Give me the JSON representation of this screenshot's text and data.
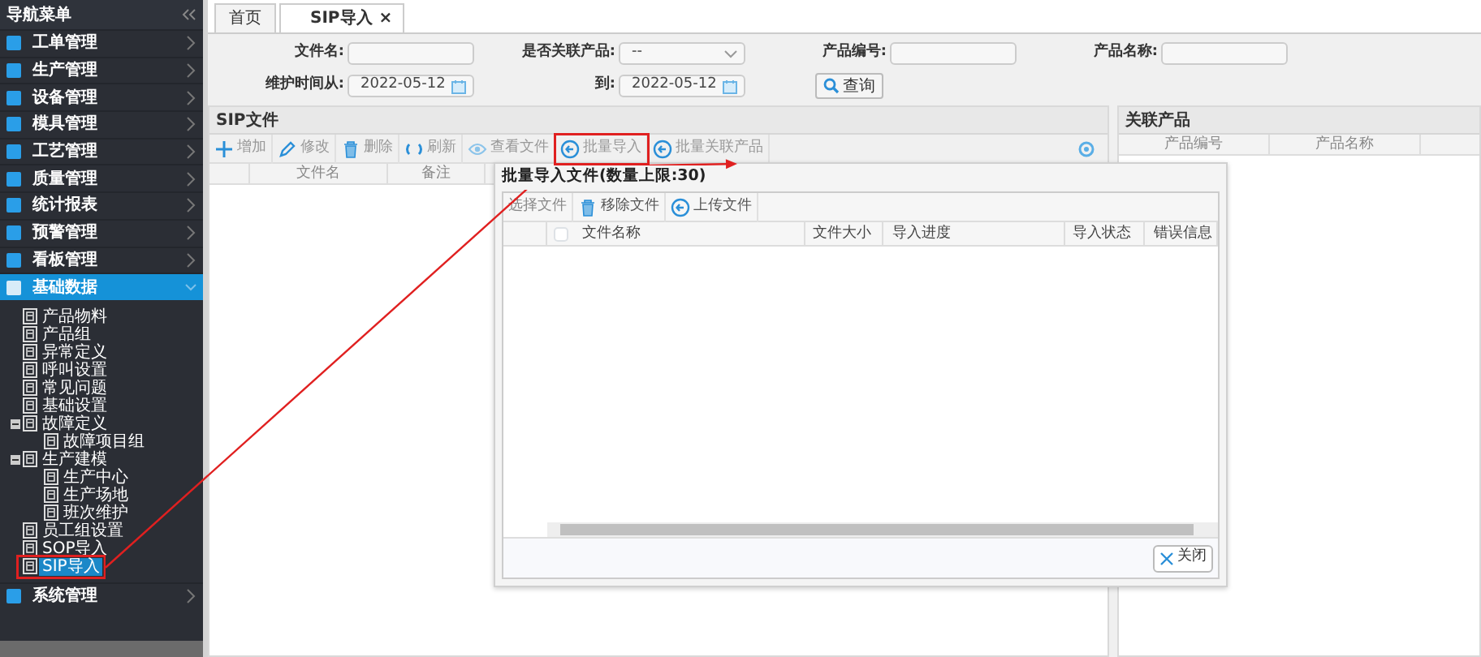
{
  "sidebar": {
    "title": "导航菜单",
    "menu": [
      {
        "label": "工单管理",
        "selected": false,
        "expanded": false
      },
      {
        "label": "生产管理",
        "selected": false,
        "expanded": false
      },
      {
        "label": "设备管理",
        "selected": false,
        "expanded": false
      },
      {
        "label": "模具管理",
        "selected": false,
        "expanded": false
      },
      {
        "label": "工艺管理",
        "selected": false,
        "expanded": false
      },
      {
        "label": "质量管理",
        "selected": false,
        "expanded": false
      },
      {
        "label": "统计报表",
        "selected": false,
        "expanded": false
      },
      {
        "label": "预警管理",
        "selected": false,
        "expanded": false
      },
      {
        "label": "看板管理",
        "selected": false,
        "expanded": false
      },
      {
        "label": "基础数据",
        "selected": true,
        "expanded": true,
        "children": [
          {
            "label": "产品物料",
            "selected": false
          },
          {
            "label": "产品组",
            "selected": false
          },
          {
            "label": "异常定义",
            "selected": false
          },
          {
            "label": "呼叫设置",
            "selected": false
          },
          {
            "label": "常见问题",
            "selected": false
          },
          {
            "label": "基础设置",
            "selected": false
          },
          {
            "label": "故障定义",
            "selected": false,
            "expanded": true,
            "children": [
              {
                "label": "故障项目组",
                "selected": false
              }
            ]
          },
          {
            "label": "生产建模",
            "selected": false,
            "expanded": true,
            "children": [
              {
                "label": "生产中心",
                "selected": false
              },
              {
                "label": "生产场地",
                "selected": false
              },
              {
                "label": "班次维护",
                "selected": false
              }
            ]
          },
          {
            "label": "员工组设置",
            "selected": false
          },
          {
            "label": "SOP导入",
            "selected": false
          },
          {
            "label": "SIP导入",
            "selected": true
          }
        ]
      },
      {
        "label": "系统管理",
        "selected": false,
        "expanded": false
      }
    ]
  },
  "tabs": [
    {
      "label": "首页",
      "selected": false
    },
    {
      "label": "SIP导入",
      "selected": true,
      "close": "×"
    }
  ],
  "filters": [
    {
      "label": "文件名:",
      "kind": "text"
    },
    {
      "label": "是否关联产品:",
      "kind": "select",
      "value": "--"
    },
    {
      "label": "产品编号:",
      "kind": "text"
    },
    {
      "label": "产品名称:",
      "kind": "text"
    },
    {
      "label": "维护时间从:",
      "kind": "date",
      "value": "2022-05-12"
    },
    {
      "label": "到:",
      "kind": "date",
      "value": "2022-05-12"
    },
    {
      "label": "查询",
      "kind": "search"
    }
  ],
  "sip_panel": {
    "title": "SIP文件",
    "toolbar": [
      {
        "label": "增加",
        "kind": "add"
      },
      {
        "label": "修改",
        "kind": "edit"
      },
      {
        "label": "删除",
        "kind": "delete"
      },
      {
        "label": "刷新",
        "kind": "refresh"
      },
      {
        "label": "查看文件",
        "kind": "view"
      },
      {
        "label": "批量导入",
        "kind": "import"
      },
      {
        "label": "批量关联产品",
        "kind": "link"
      }
    ],
    "columns": [
      "文件名",
      "备注"
    ]
  },
  "product_panel": {
    "title": "关联产品",
    "columns": [
      "产品编号",
      "产品名称"
    ]
  },
  "dialog": {
    "title": "批量导入文件(数量上限:30)",
    "toolbar": [
      {
        "label": "选择文件",
        "kind": "plain"
      },
      {
        "label": "移除文件",
        "kind": "delete"
      },
      {
        "label": "上传文件",
        "kind": "import"
      }
    ],
    "header_checkbox": {
      "checked": false
    },
    "columns": [
      "文件名称",
      "文件大小",
      "导入进度",
      "导入状态",
      "错误信息"
    ],
    "close_button": "关闭"
  }
}
